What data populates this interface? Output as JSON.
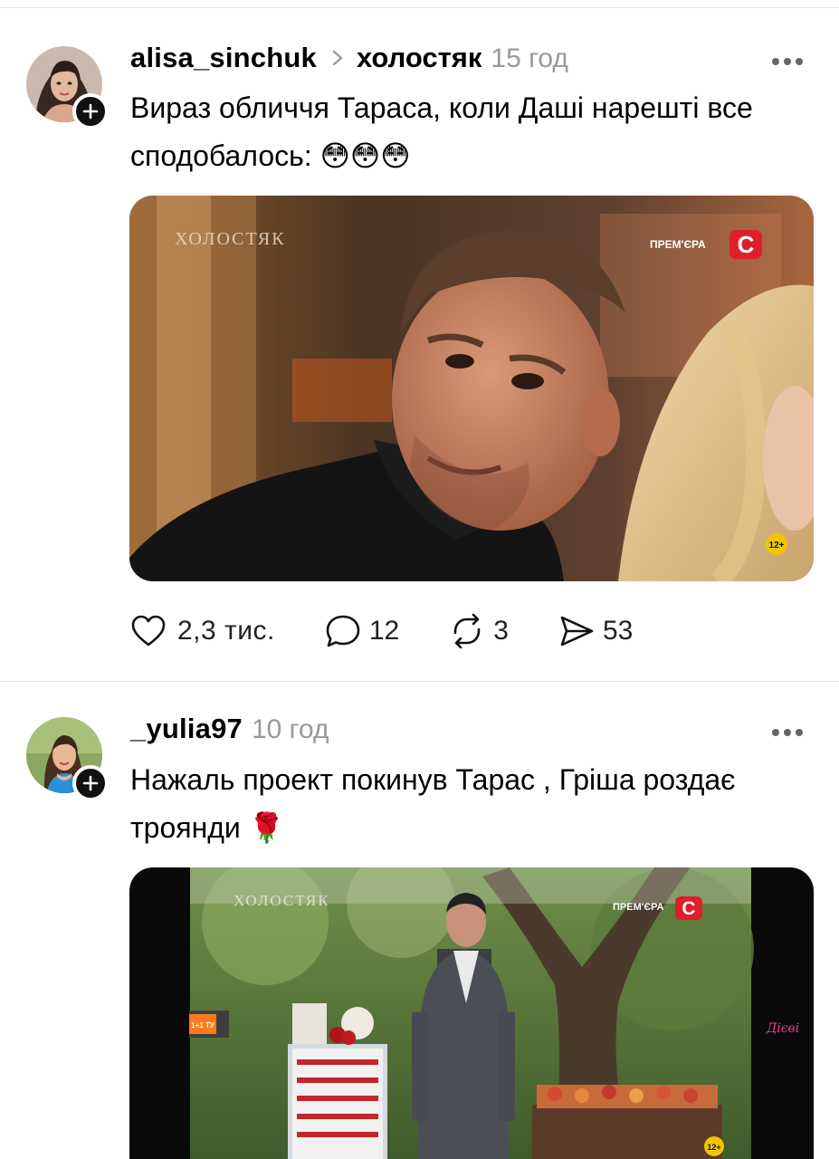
{
  "posts": [
    {
      "username": "alisa_sinchuk",
      "topic": "холостяк",
      "time": "15 год",
      "text": "Вираз обличчя Тараса, коли Даші нарешті все сподобалось: 😳😳😳",
      "media": {
        "show_logo": "ХОЛОСТЯК",
        "premiere_label": "ПРЕМ'ЄРА",
        "channel_logo": "С",
        "age_rating": "12+"
      },
      "actions": {
        "likes": "2,3 тис.",
        "comments": "12",
        "reposts": "3",
        "shares": "53"
      }
    },
    {
      "username": "_yulia97",
      "time": "10 год",
      "text": "Нажаль проект покинув Тарас , Гріша роздає троянди 🌹",
      "media": {
        "show_logo": "ХОЛОСТЯК",
        "premiere_label": "ПРЕМ'ЄРА",
        "channel_logo": "С",
        "age_rating": "12+",
        "sponsor_left": "1+1 ТУ",
        "sponsor_right": "Дієві"
      }
    }
  ],
  "icons": {
    "heart": "heart-icon",
    "comment": "comment-icon",
    "repost": "repost-icon",
    "share": "share-icon",
    "more": "more-icon",
    "follow": "plus-icon",
    "chevron": "chevron-right-icon"
  },
  "colors": {
    "channel_red": "#e01e2b",
    "muted_text": "#999999"
  }
}
